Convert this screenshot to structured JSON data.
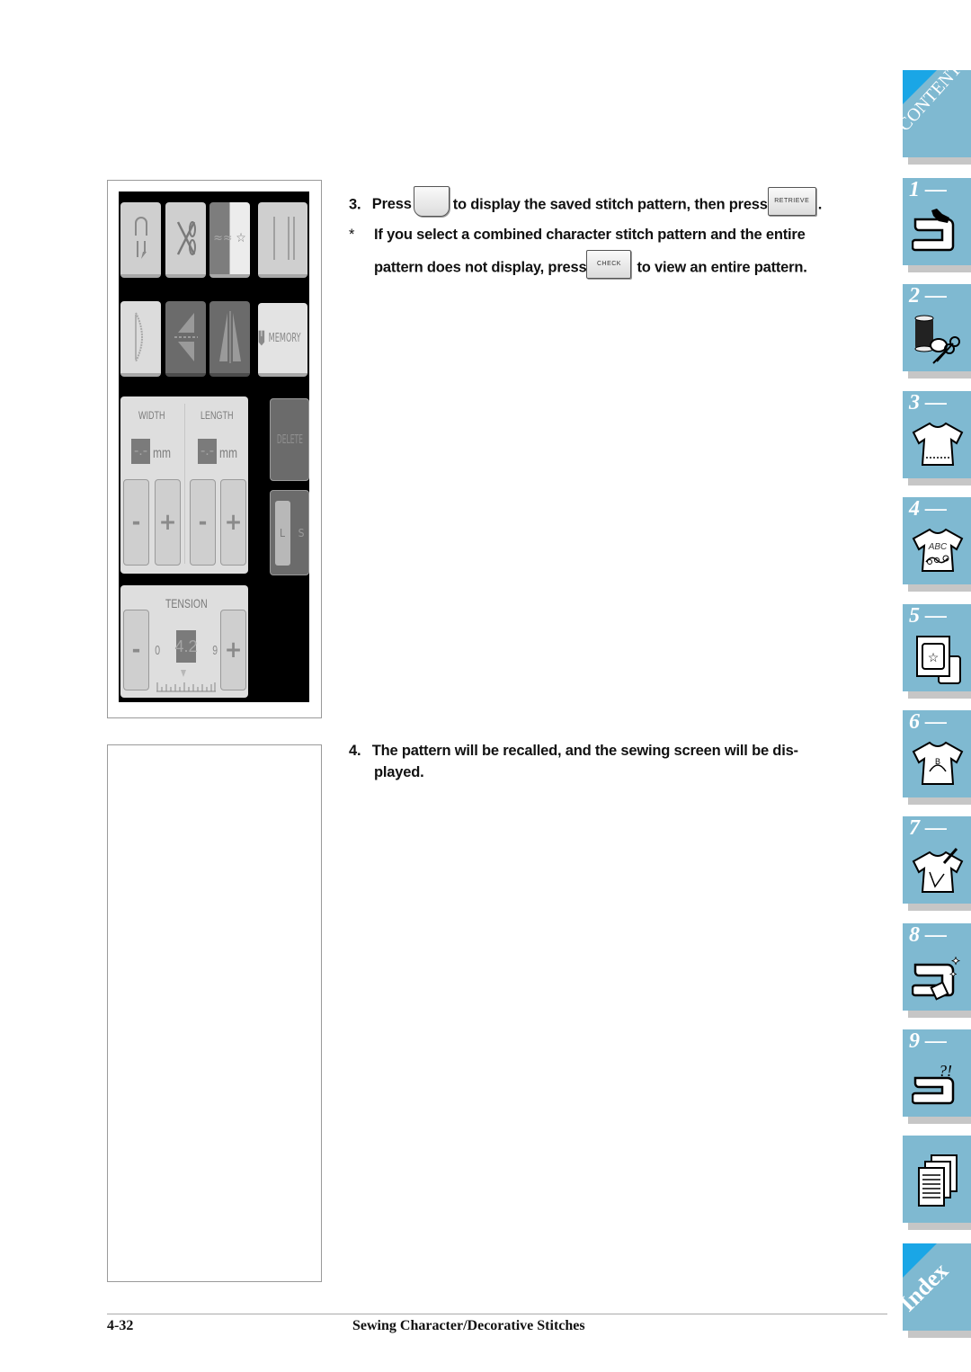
{
  "figure_screen": {
    "top_row_keys": [
      "reverse-stitch-key",
      "thread-cutter-key",
      "stitch-mode-key",
      "needle-mode-key"
    ],
    "memory_label": "MEMORY",
    "width_label": "WIDTH",
    "length_label": "LENGTH",
    "width_value": "-.-",
    "length_value": "-.-",
    "unit": "mm",
    "minus": "-",
    "plus": "+",
    "delete_label": "DELETE",
    "size_left": "L",
    "size_right": "S",
    "tension_label": "TENSION",
    "tension_value": "4.2",
    "tension_min": "0",
    "tension_max": "9"
  },
  "steps": {
    "step3": {
      "number": "3.",
      "text_a": "Press",
      "text_b": "to display the saved stitch pattern, then press",
      "text_c": ".",
      "retrieve_button": "RETRIEVE"
    },
    "note": {
      "marker": "*",
      "line1": "If you select a combined character stitch pattern and the entire",
      "line2a": "pattern does not display, press",
      "line2b": "to view an entire pattern.",
      "check_button": "CHECK"
    },
    "step4": {
      "number": "4.",
      "line1": "The pattern will be recalled, and the sewing screen will be dis-",
      "line2": "played."
    }
  },
  "side_tabs": {
    "contents": "CONTENTS",
    "chapters": [
      {
        "num": "1 —",
        "icon": "sewing-machine-hand-icon"
      },
      {
        "num": "2 —",
        "icon": "thread-spool-scissors-icon"
      },
      {
        "num": "3 —",
        "icon": "shirt-icon"
      },
      {
        "num": "4 —",
        "icon": "shirt-abc-icon",
        "icon_text": "ABC"
      },
      {
        "num": "5 —",
        "icon": "embroidery-frame-icon"
      },
      {
        "num": "6 —",
        "icon": "shirt-monogram-icon",
        "icon_text": "B"
      },
      {
        "num": "7 —",
        "icon": "shirt-pen-icon"
      },
      {
        "num": "8 —",
        "icon": "sewing-machine-sparkle-icon"
      },
      {
        "num": "9 —",
        "icon": "sewing-machine-question-icon",
        "icon_text": "?!"
      }
    ],
    "appendix_icon": "documents-icon",
    "index": "Index"
  },
  "footer": {
    "page": "4-32",
    "title": "Sewing Character/Decorative Stitches"
  },
  "colors": {
    "tab_blue": "#7fb9d1",
    "tab_corner": "#1aa6e6",
    "lcd_black": "#000000"
  }
}
